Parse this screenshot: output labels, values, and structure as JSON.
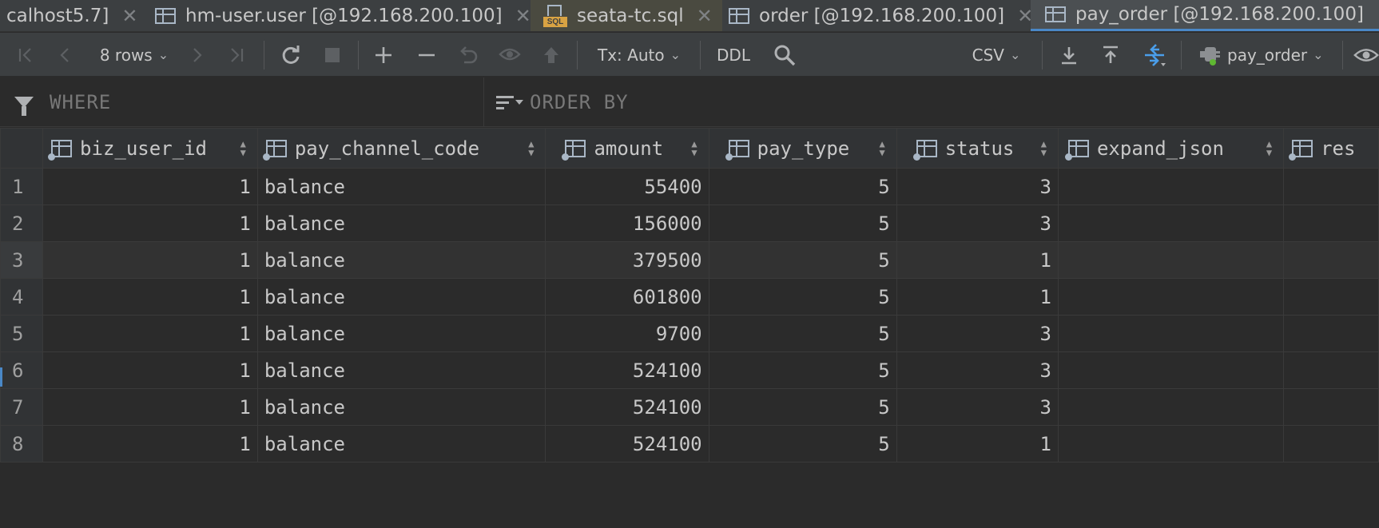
{
  "tabs": [
    {
      "label": "calhost5.7]",
      "icon": "none",
      "active": false
    },
    {
      "label": "hm-user.user [@192.168.200.100]",
      "icon": "table-icon",
      "active": false
    },
    {
      "label": "seata-tc.sql",
      "icon": "sql-file-icon",
      "active": false
    },
    {
      "label": "order [@192.168.200.100]",
      "icon": "table-icon",
      "active": false
    },
    {
      "label": "pay_order [@192.168.200.100]",
      "icon": "table-icon",
      "active": true
    }
  ],
  "toolbar": {
    "rows_label": "8 rows",
    "tx_label": "Tx: Auto",
    "ddl_label": "DDL",
    "export_format": "CSV",
    "table_selector": "pay_order"
  },
  "filter": {
    "where_placeholder": "WHERE",
    "order_placeholder": "ORDER BY"
  },
  "table": {
    "columns": [
      "biz_user_id",
      "pay_channel_code",
      "amount",
      "pay_type",
      "status",
      "expand_json",
      "res"
    ],
    "rows": [
      {
        "n": "1",
        "biz_user_id": "1",
        "pay_channel_code": "balance",
        "amount": "55400",
        "pay_type": "5",
        "status": "3"
      },
      {
        "n": "2",
        "biz_user_id": "1",
        "pay_channel_code": "balance",
        "amount": "156000",
        "pay_type": "5",
        "status": "3"
      },
      {
        "n": "3",
        "biz_user_id": "1",
        "pay_channel_code": "balance",
        "amount": "379500",
        "pay_type": "5",
        "status": "1"
      },
      {
        "n": "4",
        "biz_user_id": "1",
        "pay_channel_code": "balance",
        "amount": "601800",
        "pay_type": "5",
        "status": "1"
      },
      {
        "n": "5",
        "biz_user_id": "1",
        "pay_channel_code": "balance",
        "amount": "9700",
        "pay_type": "5",
        "status": "3"
      },
      {
        "n": "6",
        "biz_user_id": "1",
        "pay_channel_code": "balance",
        "amount": "524100",
        "pay_type": "5",
        "status": "3"
      },
      {
        "n": "7",
        "biz_user_id": "1",
        "pay_channel_code": "balance",
        "amount": "524100",
        "pay_type": "5",
        "status": "3"
      },
      {
        "n": "8",
        "biz_user_id": "1",
        "pay_channel_code": "balance",
        "amount": "524100",
        "pay_type": "5",
        "status": "1"
      }
    ]
  },
  "colors": {
    "background": "#2b2b2b",
    "toolbar": "#3c3f41",
    "active_tab_underline": "#4a88c7",
    "accent_blue": "#4a9eea",
    "online_dot": "#5fb832"
  }
}
